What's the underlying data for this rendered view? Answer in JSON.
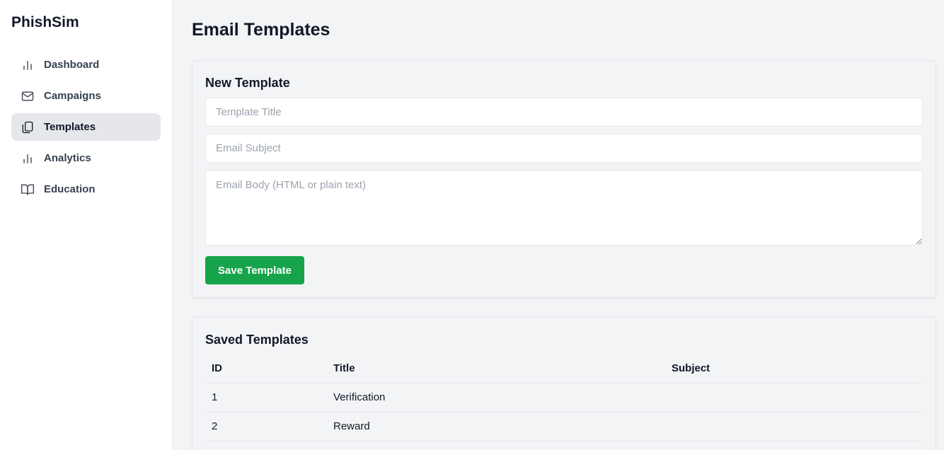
{
  "app": {
    "brand": "PhishSim"
  },
  "sidebar": {
    "items": [
      {
        "label": "Dashboard",
        "icon": "bar-chart-icon",
        "active": false
      },
      {
        "label": "Campaigns",
        "icon": "mail-icon",
        "active": false
      },
      {
        "label": "Templates",
        "icon": "copy-icon",
        "active": true
      },
      {
        "label": "Analytics",
        "icon": "bar-chart-icon",
        "active": false
      },
      {
        "label": "Education",
        "icon": "book-open-icon",
        "active": false
      }
    ]
  },
  "page": {
    "title": "Email Templates"
  },
  "new_template": {
    "title": "New Template",
    "title_placeholder": "Template Title",
    "title_value": "",
    "subject_placeholder": "Email Subject",
    "subject_value": "",
    "body_placeholder": "Email Body (HTML or plain text)",
    "body_value": "",
    "save_label": "Save Template"
  },
  "saved_templates": {
    "title": "Saved Templates",
    "columns": [
      "ID",
      "Title",
      "Subject"
    ],
    "rows": [
      {
        "id": "1",
        "title": "Verification",
        "subject": ""
      },
      {
        "id": "2",
        "title": "Reward",
        "subject": ""
      }
    ]
  },
  "colors": {
    "accent": "#16a34a",
    "active_nav_bg": "#e5e7eb",
    "page_bg": "#f3f4f6"
  }
}
